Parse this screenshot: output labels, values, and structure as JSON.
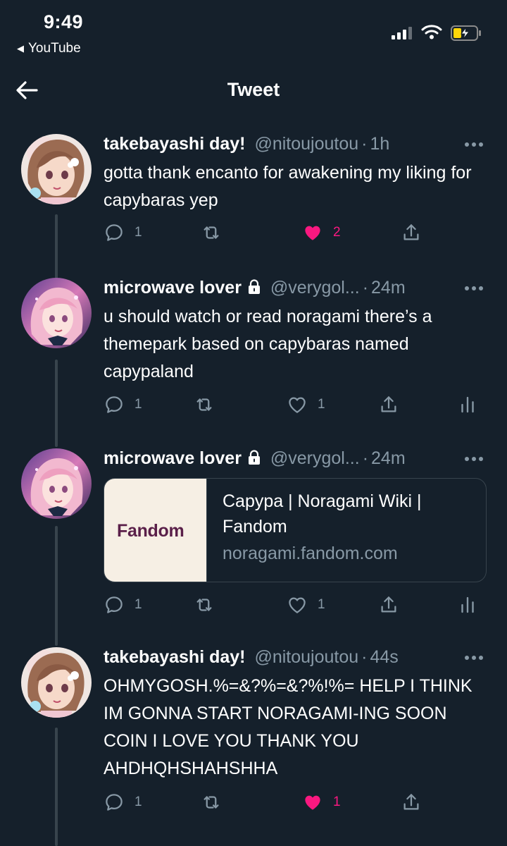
{
  "status_bar": {
    "time": "9:49",
    "back_app": "YouTube",
    "icons": [
      "signal-icon",
      "wifi-icon",
      "battery-charging-icon"
    ]
  },
  "header": {
    "title": "Tweet",
    "back_icon": "arrow-left-icon"
  },
  "colors": {
    "background": "#15202b",
    "text": "#ffffff",
    "secondary": "#8899a6",
    "like": "#f91880",
    "divider": "#38444d"
  },
  "tweets": [
    {
      "name": "takebayashi day!",
      "handle": "@nitoujoutou",
      "time": "1h",
      "locked": false,
      "text": "gotta thank encanto for awakening my liking for capybaras yep",
      "replies": "1",
      "retweets": "",
      "likes": "2",
      "liked": true
    },
    {
      "name": "microwave lover",
      "handle": "@verygol...",
      "time": "24m",
      "locked": true,
      "text": "u should watch or read noragami there’s a themepark based on capybaras named capypaland",
      "replies": "1",
      "retweets": "",
      "likes": "1",
      "liked": false
    },
    {
      "name": "microwave lover",
      "handle": "@verygol...",
      "time": "24m",
      "locked": true,
      "text": "",
      "card": {
        "brand": "Fandom",
        "title": "Capypa | Noragami Wiki | Fandom",
        "domain": "noragami.fandom.com"
      },
      "replies": "1",
      "retweets": "",
      "likes": "1",
      "liked": false
    },
    {
      "name": "takebayashi day!",
      "handle": "@nitoujoutou",
      "time": "44s",
      "locked": false,
      "text": "OHMYGOSH.%=&?%=&?%!%= HELP I THINK IM GONNA START NORAGAMI-ING SOON COIN I LOVE YOU THANK YOU AHDHQHSHAHSHHA",
      "replies": "1",
      "retweets": "",
      "likes": "1",
      "liked": true
    }
  ]
}
